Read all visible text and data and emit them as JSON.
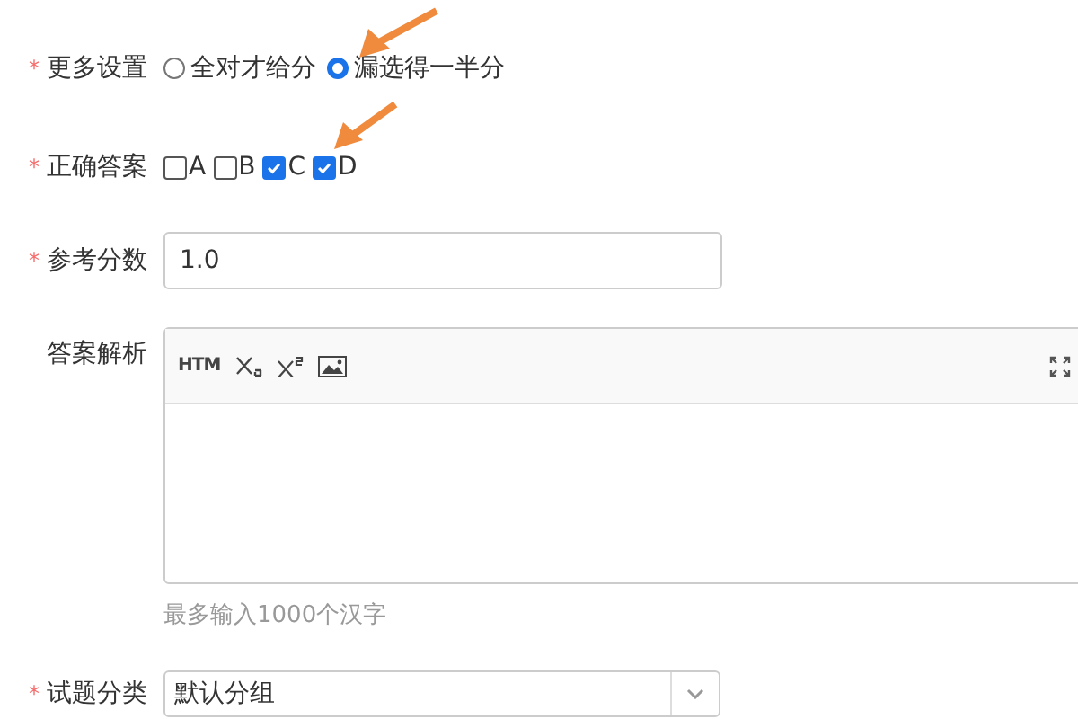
{
  "form": {
    "rows": [
      {
        "kind": "radio",
        "label": "更多设置",
        "mark": "*",
        "options": [
          {
            "label": "全对才给分",
            "selected": false
          },
          {
            "label": "漏选得一半分",
            "selected": true
          }
        ]
      },
      {
        "kind": "checkbox",
        "label": "正确答案",
        "mark": "*",
        "options": [
          {
            "label": "A",
            "checked": false
          },
          {
            "label": "B",
            "checked": false
          },
          {
            "label": "C",
            "checked": true
          },
          {
            "label": "D",
            "checked": true
          }
        ]
      },
      {
        "kind": "input",
        "label": "参考分数",
        "mark": "*",
        "value": "1.0"
      },
      {
        "kind": "editor",
        "label": "答案解析",
        "toolbar": [
          {
            "kind": "html",
            "text": "HTM"
          },
          {
            "kind": "subscript"
          },
          {
            "kind": "superscript"
          },
          {
            "kind": "image"
          }
        ],
        "hint": "最多输入1000个汉字"
      },
      {
        "kind": "select",
        "label": "试题分类",
        "mark": "*",
        "value": "默认分组"
      }
    ]
  }
}
